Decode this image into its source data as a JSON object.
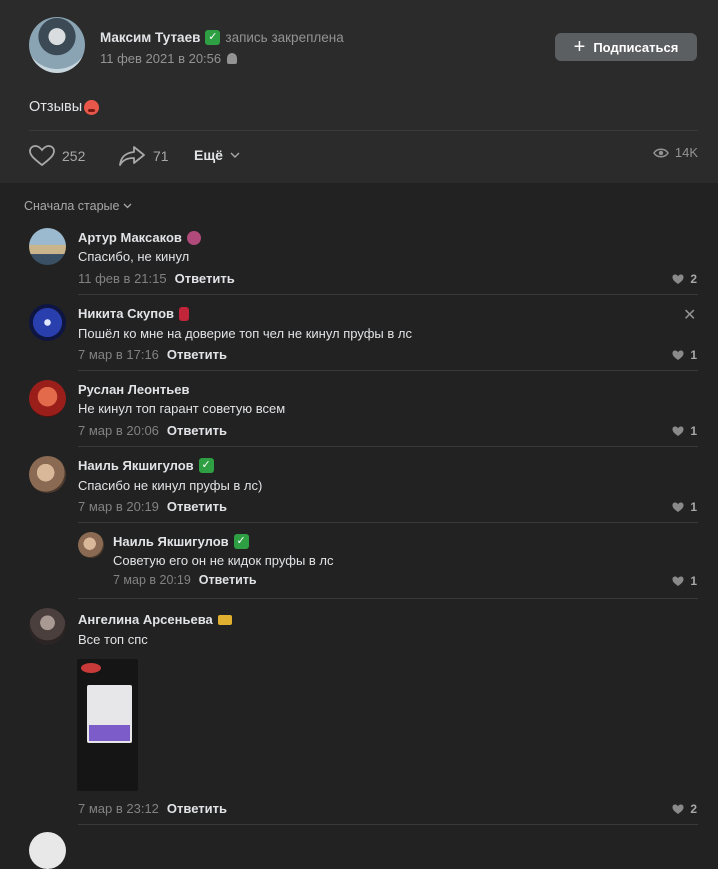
{
  "post": {
    "author": "Максим Тутаев",
    "pinned_label": "запись закреплена",
    "date": "11 фев 2021 в 20:56",
    "subscribe_label": "Подписаться",
    "text": "Отзывы",
    "likes": "252",
    "shares": "71",
    "more_label": "Ещё",
    "views": "14K"
  },
  "sort_label": "Сначала старые",
  "reply_label": "Ответить",
  "comments": [
    {
      "name": "Артур Максаков",
      "text": "Спасибо, не кинул",
      "date": "11 фев в 21:15",
      "likes": "2"
    },
    {
      "name": "Никита Скупов",
      "text": "Пошёл ко мне на доверие топ чел не кинул пруфы в лс",
      "date": "7 мар в 17:16",
      "likes": "1"
    },
    {
      "name": "Руслан Леонтьев",
      "text": "Не кинул топ гарант советую всем",
      "date": "7 мар в 20:06",
      "likes": "1"
    },
    {
      "name": "Наиль Якшигулов",
      "text": "Спасибо не кинул пруфы в лс)",
      "date": "7 мар в 20:19",
      "likes": "1"
    },
    {
      "name": "Наиль Якшигулов",
      "text": "Советую его он не кидок пруфы в лс",
      "date": "7 мар в 20:19",
      "likes": "1"
    },
    {
      "name": "Ангелина Арсеньева",
      "text": "Все топ спс",
      "date": "7 мар в 23:12",
      "likes": "2"
    }
  ],
  "colors": {
    "background": "#222222",
    "post_bg": "#2b2b2b",
    "button": "#5c5f62",
    "verified": "#2ea043"
  }
}
